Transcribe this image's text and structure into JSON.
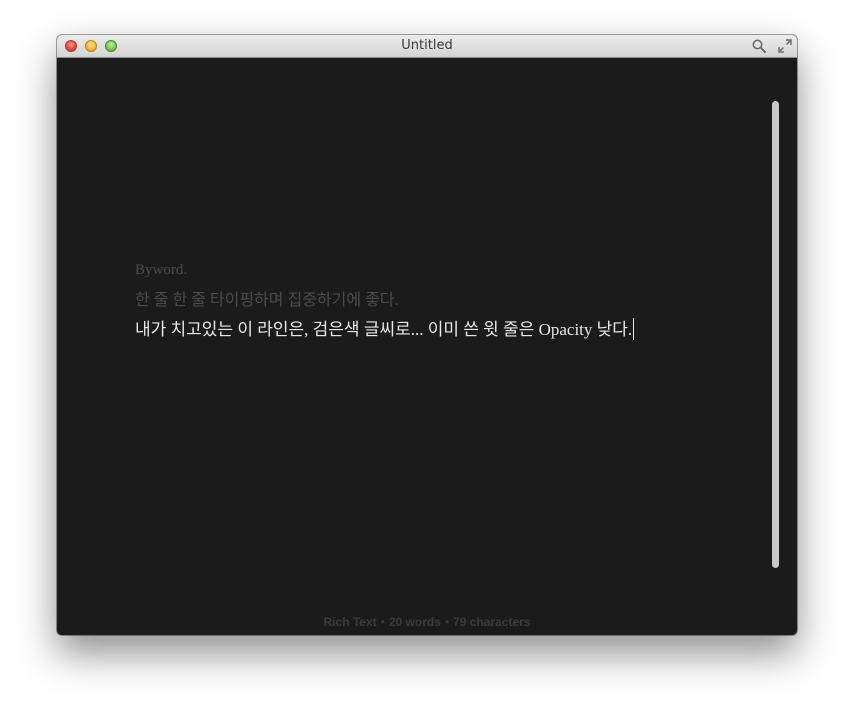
{
  "window": {
    "title": "Untitled"
  },
  "titlebar": {
    "close_icon": "close-button",
    "minimize_icon": "minimize-button",
    "zoom_icon": "zoom-button",
    "search_icon": "search-icon",
    "fullscreen_icon": "fullscreen-icon"
  },
  "document": {
    "lines": [
      "Byword.",
      "한 줄 한 줄 타이핑하며 집중하기에 좋다.",
      "내가 치고있는 이 라인은, 검은색 글씨로... 이미 쓴 윗 줄은 Opacity 낮다."
    ]
  },
  "status": {
    "format": "Rich Text",
    "separator": "•",
    "words": "20 words",
    "characters": "79 characters"
  },
  "colors": {
    "background": "#1b1b1b",
    "faded_text": "#4a4a4a",
    "active_text": "#e8e8e8",
    "scrollbar": "#c9c9c9"
  }
}
